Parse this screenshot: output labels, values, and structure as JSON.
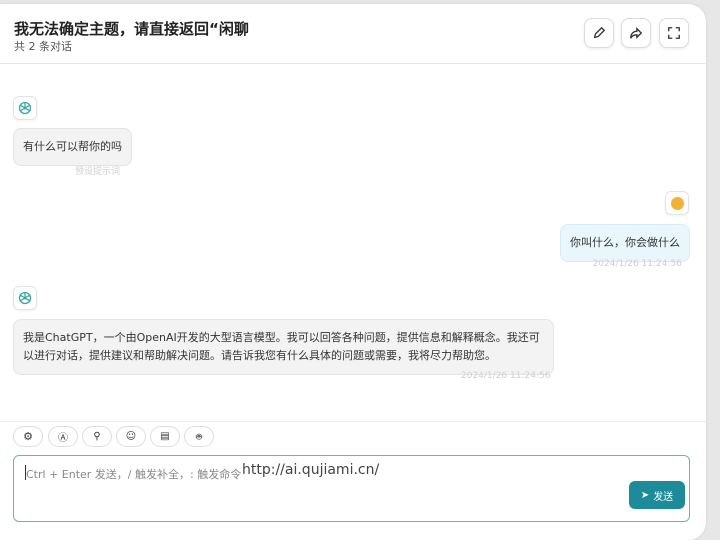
{
  "header": {
    "title": "我无法确定主题，请直接返回“闲聊",
    "subtitle": "共 2 条对话"
  },
  "messages": [
    {
      "role": "bot",
      "text": "有什么可以帮你的吗",
      "meta": "预设提示词"
    },
    {
      "role": "user",
      "text": "你叫什么，你会做什么",
      "meta": "2024/1/26 11:24:56"
    },
    {
      "role": "bot",
      "text": "我是ChatGPT，一个由OpenAI开发的大型语言模型。我可以回答各种问题，提供信息和解释概念。我还可以进行对话，提供建议和帮助解决问题。请告诉我您有什么具体的问题或需要，我将尽力帮助您。",
      "meta": "2024/1/26 11:24:56"
    }
  ],
  "input": {
    "placeholder": "Ctrl + Enter 发送，/ 触发补全，: 触发命令",
    "overlay_url": "http://ai.qujiami.cn/",
    "send_label": "发送"
  },
  "colors": {
    "accent": "#1d8b9a",
    "user_bubble": "#e9f6fc",
    "bot_bubble": "#f3f3f3"
  }
}
